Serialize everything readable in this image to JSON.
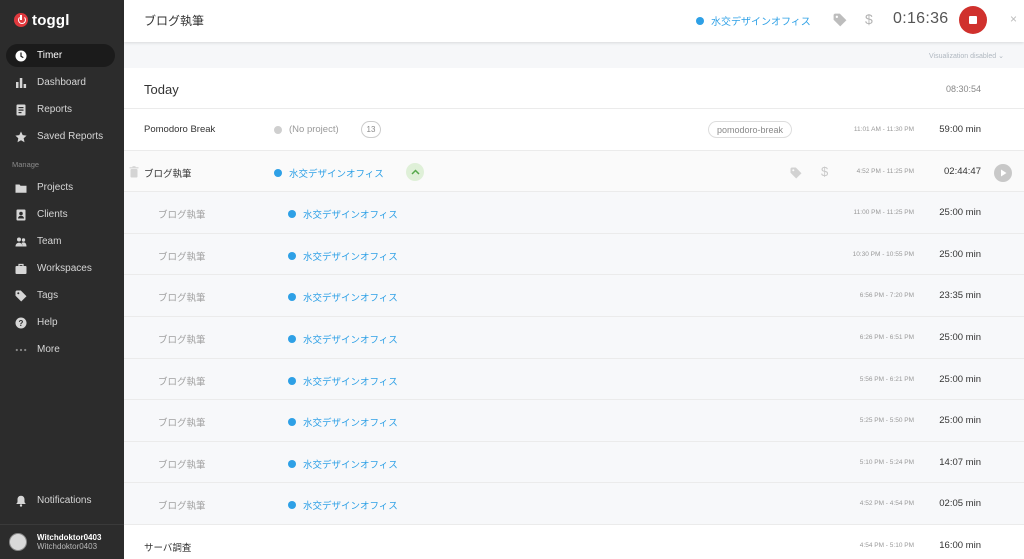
{
  "sidebar": {
    "logo": "toggl",
    "items": [
      {
        "label": "Timer",
        "icon": "clock-icon",
        "active": true
      },
      {
        "label": "Dashboard",
        "icon": "bar-chart-icon"
      },
      {
        "label": "Reports",
        "icon": "report-icon"
      },
      {
        "label": "Saved Reports",
        "icon": "star-icon"
      }
    ],
    "manage_label": "Manage",
    "manage_items": [
      {
        "label": "Projects",
        "icon": "folder-icon"
      },
      {
        "label": "Clients",
        "icon": "client-icon"
      },
      {
        "label": "Team",
        "icon": "team-icon"
      },
      {
        "label": "Workspaces",
        "icon": "briefcase-icon"
      },
      {
        "label": "Tags",
        "icon": "tag-icon"
      },
      {
        "label": "Help",
        "icon": "help-icon"
      },
      {
        "label": "More",
        "icon": "more-icon"
      }
    ],
    "notifications": "Notifications",
    "user_name": "Witchdoktor0403",
    "user_email": "Witchdoktor0403"
  },
  "timer": {
    "description": "ブログ執筆",
    "project": "水交デザインオフィス",
    "elapsed": "0:16:36",
    "project_color": "#2ea0e6",
    "stop_color": "#d0312d"
  },
  "visualization": "Visualization disabled",
  "day": {
    "title": "Today",
    "total": "08:30:54"
  },
  "entries": [
    {
      "desc": "Pomodoro Break",
      "project": "(No project)",
      "count": "13",
      "tag": "pomodoro-break",
      "range": "11:01 AM - 11:30 PM",
      "duration": "59:00 min"
    },
    {
      "desc": "ブログ執筆",
      "project": "水交デザインオフィス",
      "range": "4:52 PM - 11:25 PM",
      "duration": "02:44:47"
    }
  ],
  "subentries": [
    {
      "desc": "ブログ執筆",
      "project": "水交デザインオフィス",
      "range": "11:00 PM - 11:25 PM",
      "duration": "25:00 min"
    },
    {
      "desc": "ブログ執筆",
      "project": "水交デザインオフィス",
      "range": "10:30 PM - 10:55 PM",
      "duration": "25:00 min"
    },
    {
      "desc": "ブログ執筆",
      "project": "水交デザインオフィス",
      "range": "6:56 PM - 7:20 PM",
      "duration": "23:35 min"
    },
    {
      "desc": "ブログ執筆",
      "project": "水交デザインオフィス",
      "range": "6:26 PM - 6:51 PM",
      "duration": "25:00 min"
    },
    {
      "desc": "ブログ執筆",
      "project": "水交デザインオフィス",
      "range": "5:56 PM - 6:21 PM",
      "duration": "25:00 min"
    },
    {
      "desc": "ブログ執筆",
      "project": "水交デザインオフィス",
      "range": "5:25 PM - 5:50 PM",
      "duration": "25:00 min"
    },
    {
      "desc": "ブログ執筆",
      "project": "水交デザインオフィス",
      "range": "5:10 PM - 5:24 PM",
      "duration": "14:07 min"
    },
    {
      "desc": "ブログ執筆",
      "project": "水交デザインオフィス",
      "range": "4:52 PM - 4:54 PM",
      "duration": "02:05 min"
    }
  ],
  "last_entry": {
    "desc": "サーバ調査",
    "range": "4:54 PM - 5:10 PM",
    "duration": "16:00 min"
  }
}
